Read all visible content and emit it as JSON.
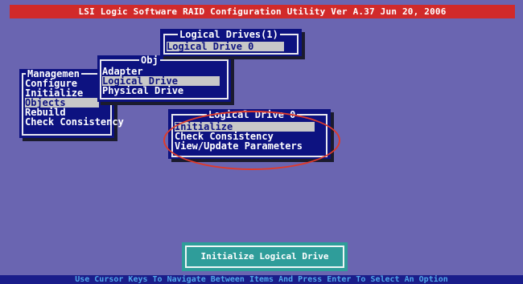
{
  "title_bar": "LSI Logic Software RAID Configuration Utility Ver A.37 Jun 20, 2006",
  "management_menu": {
    "title": "Managemen",
    "items": [
      "Configure",
      "Initialize",
      "Objects",
      "Rebuild",
      "Check Consistency"
    ],
    "selected": "Objects"
  },
  "objects_menu": {
    "title": "Obj",
    "items": [
      "Adapter",
      "Logical Drive",
      "Physical Drive"
    ],
    "selected": "Logical Drive"
  },
  "logical_drives_menu": {
    "title": "Logical Drives(1)",
    "items": [
      "Logical Drive 0"
    ],
    "selected": "Logical Drive 0"
  },
  "logical_drive_menu": {
    "title": "Logical Drive 0",
    "items": [
      "Initialize",
      "Check Consistency",
      "View/Update Parameters"
    ],
    "selected": "Initialize"
  },
  "footer_label": "Initialize Logical Drive",
  "status_bar": "Use Cursor Keys To Navigate Between Items And Press Enter To Select An Option",
  "colors": {
    "background": "#6a65b1",
    "panel": "#0d1280",
    "title_bar": "#d12a2a",
    "footer": "#2f9d9a",
    "highlight_ellipse": "#e03a2a"
  }
}
